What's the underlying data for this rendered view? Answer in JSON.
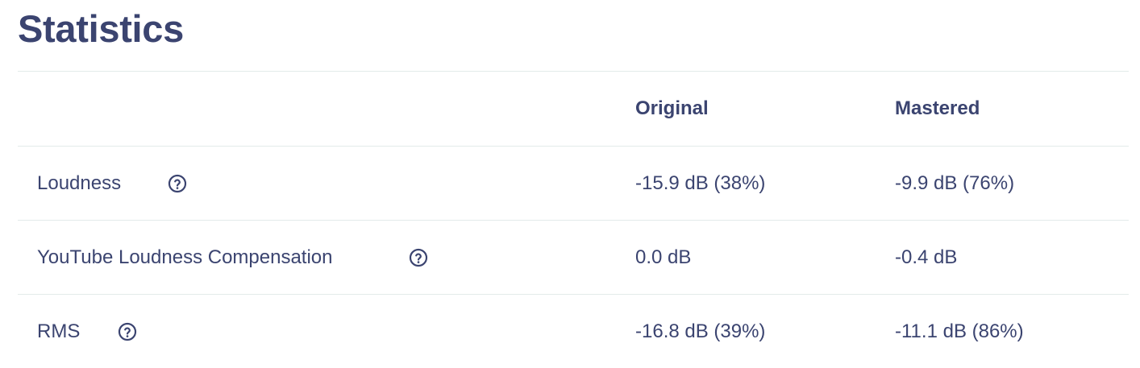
{
  "page": {
    "title": "Statistics"
  },
  "table": {
    "headers": {
      "label": "",
      "original": "Original",
      "mastered": "Mastered"
    },
    "rows": [
      {
        "label": "Loudness",
        "original": "-15.9 dB (38%)",
        "mastered": "-9.9 dB (76%)",
        "icon": "help-circle-icon"
      },
      {
        "label": "YouTube Loudness Compensation",
        "original": "0.0 dB",
        "mastered": "-0.4 dB",
        "icon": "help-circle-icon"
      },
      {
        "label": "RMS",
        "original": "-16.8 dB (39%)",
        "mastered": "-11.1 dB (86%)",
        "icon": "help-circle-icon"
      }
    ]
  },
  "colors": {
    "text": "#3b4470",
    "divider": "#e3ebea",
    "background": "#ffffff"
  }
}
